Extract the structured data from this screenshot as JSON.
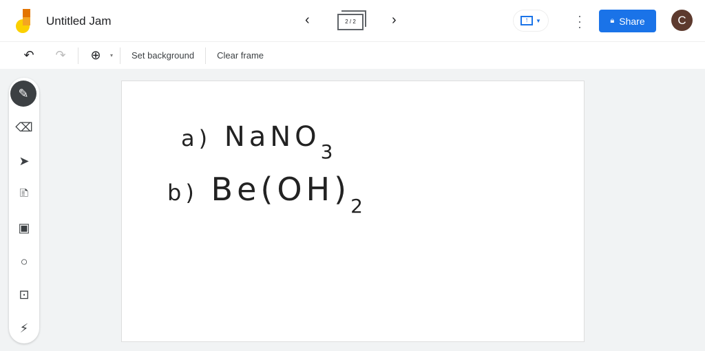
{
  "app": {
    "title": "Untitled Jam",
    "frame_counter": "2 / 2",
    "share_label": "Share",
    "avatar_initial": "C"
  },
  "toolbar": {
    "set_background": "Set background",
    "clear_frame": "Clear frame"
  },
  "tools": [
    "pen",
    "eraser",
    "select",
    "sticky-note",
    "image",
    "shape",
    "text-box",
    "laser"
  ],
  "canvas": {
    "line1": {
      "label": "a)",
      "formula": "NaNO",
      "sub": "3"
    },
    "line2": {
      "label": "b)",
      "formula": "Be(OH)",
      "sub": "2"
    }
  },
  "colors": {
    "accent": "#1a73e8",
    "avatar": "#5d3a2e"
  }
}
